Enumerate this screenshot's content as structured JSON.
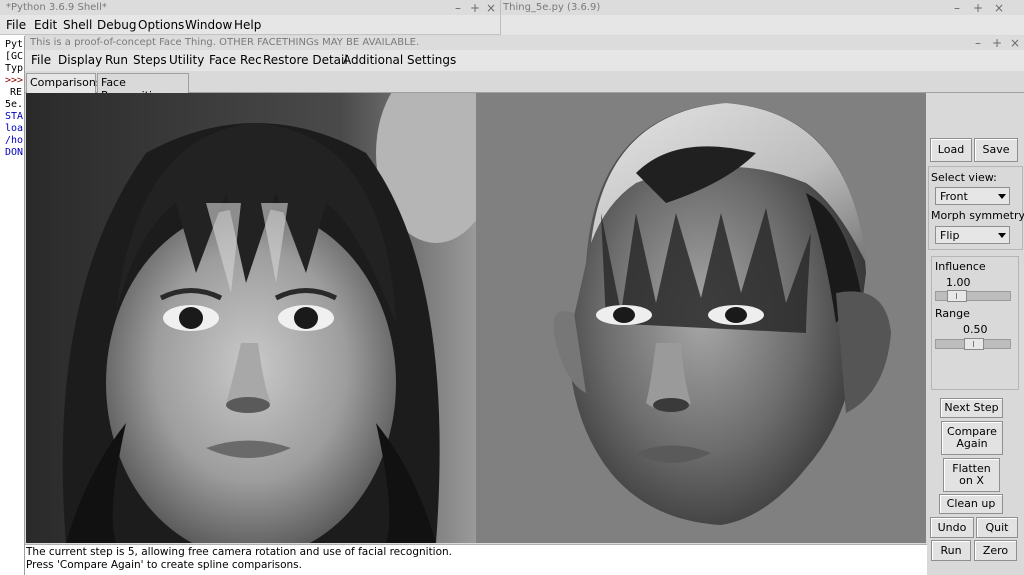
{
  "shell_window": {
    "title": "*Python 3.6.9 Shell*",
    "menu": [
      "File",
      "Edit",
      "Shell",
      "Debug",
      "Options",
      "Window",
      "Help"
    ],
    "visible_lines": [
      "Pyt",
      "[GC",
      "Typ",
      ">>>",
      "RE",
      "5e.",
      "STA",
      "loa",
      "/ho",
      "DON"
    ]
  },
  "editor_window": {
    "title": "Thing_5e.py (3.6.9)"
  },
  "app_window": {
    "title": "This is a proof-of-concept Face Thing.  OTHER FACETHINGs MAY BE AVAILABLE.",
    "menu": [
      "File",
      "Display",
      "Run",
      "Steps",
      "Utility",
      "Face Rec",
      "Restore Detail",
      "Additional Settings"
    ],
    "tabs": [
      "Comparisons",
      "Face Recognition"
    ],
    "controls": {
      "load": "Load",
      "save": "Save",
      "select_view_label": "Select view:",
      "select_view_value": "Front",
      "morph_symmetry_label": "Morph symmetry:",
      "morph_symmetry_value": "Flip",
      "influence_label": "Influence",
      "influence_value": "1.00",
      "influence_fraction": 0.2,
      "range_label": "Range",
      "range_value": "0.50",
      "range_fraction": 0.5,
      "next_step": "Next Step",
      "compare_again": "Compare\nAgain",
      "flatten_on_x": "Flatten\non X",
      "clean_up": "Clean up",
      "undo": "Undo",
      "quit": "Quit",
      "run": "Run",
      "zero": "Zero"
    },
    "status_lines": [
      "The current step is 5, allowing free camera rotation and use of facial recognition.",
      "Press 'Compare Again' to create spline comparisons."
    ]
  },
  "colors": {
    "shell_blue": "#0000c0",
    "shell_prompt": "#8b0000",
    "viewport_gray": "#808080"
  }
}
